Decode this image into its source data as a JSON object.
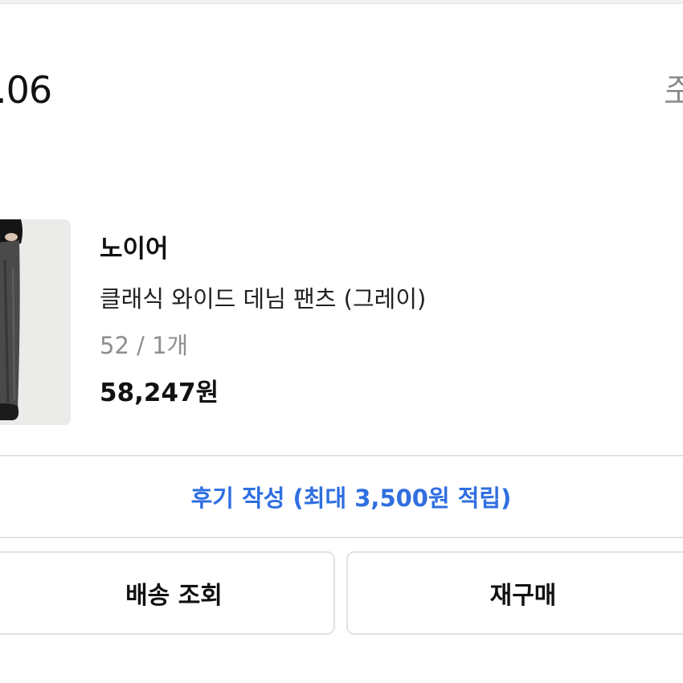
{
  "order": {
    "date_fragment": ".06",
    "detail_link_fragment": "주",
    "status_fragment": "!"
  },
  "product": {
    "brand": "노이어",
    "name": "클래식 와이드 데님 팬츠 (그레이)",
    "option": "52 / 1개",
    "price": "58,247원",
    "thumbnail_icon": "denim-pants-photo"
  },
  "actions": {
    "review_label": "후기 작성 (최대 3,500원 적립)",
    "shipping_label": "배송 조회",
    "reorder_label": "재구매"
  },
  "colors": {
    "accent_blue": "#2f6fe0",
    "muted_text": "#8e8e8e",
    "border": "#e2e2e2"
  }
}
